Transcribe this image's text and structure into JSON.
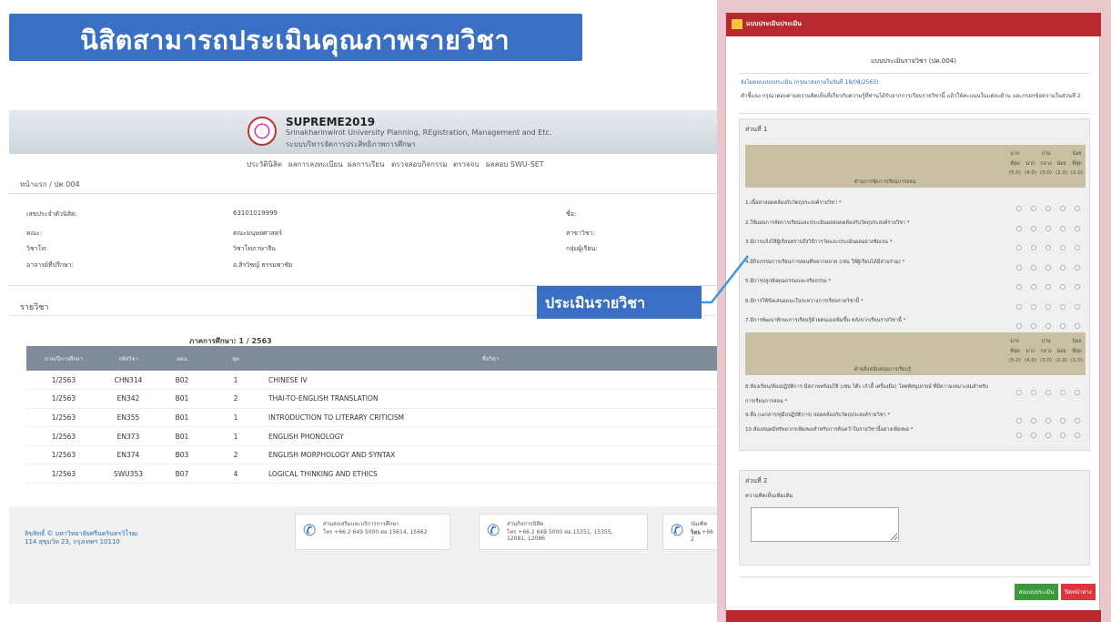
{
  "banner": {
    "title": "นิสิตสามารถประเมินคุณภาพรายวิชา"
  },
  "portal": {
    "logo_title": "SUPREME2019",
    "logo_sub1": "Srinakharinwirot University Planning, REgistration, Management and Etc.",
    "logo_sub2": "ระบบบริหารจัดการประสิทธิภาพการศึกษา",
    "nav": [
      "ประวัตินิสิต",
      "ผลการลงทะเบียน",
      "ผลการเรียน",
      "ตรวจสอบกิจกรรม",
      "ตรวจจบ",
      "ผลสอบ SWU-SET"
    ],
    "breadcrumb": "หน้าแรก / ปค 004",
    "info": {
      "id_label": "เลขประจำตัวนิสิต:",
      "id_value": "63101019999",
      "faculty_label": "คณะ:",
      "faculty_value": "คณะมนุษยศาสตร์",
      "major_label": "วิชาโท:",
      "major_value": "วิชาโทภาษาจีน",
      "advisor_label": "อาจารย์ที่ปรึกษา:",
      "advisor_value": "อ.สิรวิชญ์ ธรรมพาชัย",
      "name_label": "ชื่อ:",
      "branch_label": "สาขาวิชา:",
      "group_label": "กลุ่มผู้เรียน:"
    },
    "section_title": "รายวิชา",
    "term": "ภาคการศึกษา: 1 / 2563",
    "table": {
      "headers": [
        "ภาค/ปีการศึกษา",
        "รหัสวิชา",
        "ตอน",
        "ชุด",
        "ชื่อวิชา"
      ],
      "rows": [
        [
          "1/2563",
          "CHN314",
          "B02",
          "1",
          "CHINESE IV"
        ],
        [
          "1/2563",
          "EN342",
          "B01",
          "2",
          "THAI-TO-ENGLISH TRANSLATION"
        ],
        [
          "1/2563",
          "EN355",
          "B01",
          "1",
          "INTRODUCTION TO LITERARY CRITICISM"
        ],
        [
          "1/2563",
          "EN373",
          "B01",
          "1",
          "ENGLISH PHONOLOGY"
        ],
        [
          "1/2563",
          "EN374",
          "B03",
          "2",
          "ENGLISH MORPHOLOGY AND SYNTAX"
        ],
        [
          "1/2563",
          "SWU353",
          "B07",
          "4",
          "LOGICAL THINKING AND ETHICS"
        ]
      ]
    },
    "footer": {
      "copyright": "ลิขสิทธิ์ © มหาวิทยาลัยศรีนครินทรวิโรฒ",
      "address": "114 สุขุมวิท 23, กรุงเทพฯ 10110",
      "contact1": [
        "ส่วนส่งเสริมและบริการการศึกษา",
        "โทร +66 2 649 5000 ต่อ 15614, 15662",
        ""
      ],
      "contact2": [
        "ส่วนกิจการนิสิต",
        "โทร +66 2 649 5000 ต่อ 15351, 15355,",
        "12081, 12086"
      ],
      "contact3": [
        "บัณฑิตวิทย",
        "โทร +66 2",
        ""
      ]
    }
  },
  "callout": {
    "label": "ประเมินรายวิชา"
  },
  "panel": {
    "header": "แบบประเมินประเมิน",
    "form_title": "แบบประเมินรายวิชา (ปค.004)",
    "status": "ยังไม่ตอบแบบประเมิน (กรุณาส่งภายในวันที่ 18/08/2563)",
    "instruction": "คำชี้แจง กรุณาตอบตามความคิดเห็นที่เกี่ยวกับความรู้ที่ท่านได้รับจากการเรียนรายวิชานี้ แล้วให้คะแนนในแต่ละด้าน และกรอกข้อความในส่วนที่ 2",
    "part1_label": "ส่วนที่ 1",
    "part2_label": "ส่วนที่ 2",
    "part2_prompt": "ความคิดเห็นเพิ่มเติม",
    "scale_top": [
      "มาก",
      "",
      "ปาน",
      "",
      "น้อย"
    ],
    "scale_mid": [
      "ที่สุด",
      "มาก",
      "กลาง",
      "น้อย",
      "ที่สุด"
    ],
    "scale_bot": [
      "(5.0)",
      "(4.0)",
      "(3.0)",
      "(2.0)",
      "(1.0)"
    ],
    "group1_title": "ด้านการจัดการเรียนการสอน",
    "group2_title": "ด้านสิ่งสนับสนุนการเรียนรู้",
    "group1": [
      "1.เนื้อหาสอดคล้องกับวัตถุประสงค์รายวิชา",
      "2.ใช้แผนการจัดการเรียนและประเมินผลสอดคล้องกับวัตถุประสงค์รายวิชา",
      "3.มีการแจ้งให้ผู้เรียนทราบถึงวิธีการวัดและประเมินผลอย่างชัดเจน",
      "4.มีกิจกรรมการเรียนการสอนที่หลากหลาย (เช่น ให้ผู้เรียนได้มีส่วนร่วม)",
      "5.มีการปลูกฝังคุณธรรมและจริยธรรม",
      "6.มีการให้ข้อเสนอแนะในระหว่างการเรียนรายวิชานี้",
      "7.มีการพัฒนาทักษะการเรียนรู้ด้วยตนเองเพิ่มขึ้น หลังจากเรียนรายวิชานี้"
    ],
    "group2": [
      "8.ห้องเรียน/ห้องปฏิบัติการ มีสภาพพร้อมใช้ (เช่น โต๊ะ เก้าอี้ เครื่องมือ) โสตทัศนูปกรณ์ ที่มีความเหมาะสมสำหรับ",
      "การเรียนการสอน",
      "9.สื่อ (เอกสาร/คู่มือปฏิบัติการ) สอดคล้องกับวัตถุประสงค์รายวิชา",
      "10.ห้องสมุดมีทรัพยากรเพียงพอสำหรับการค้นคว้าในรายวิชานี้อย่างเพียงพอ"
    ],
    "save_label": "ส่งแบบประเมิน",
    "close_label": "ปิดหน้าต่าง"
  }
}
